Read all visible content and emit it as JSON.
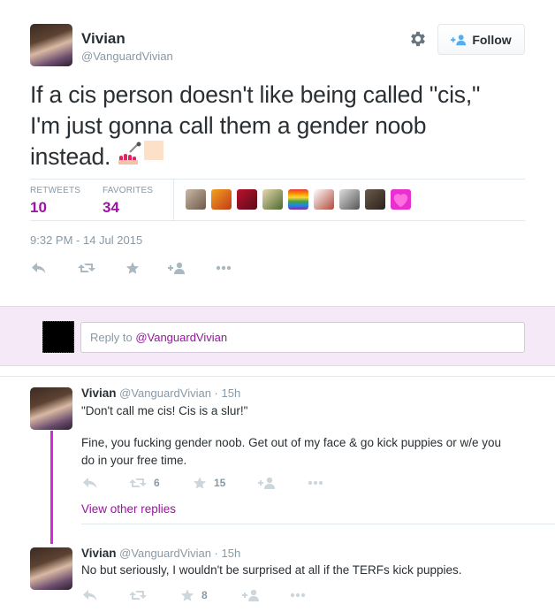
{
  "tweet": {
    "author_name": "Vivian",
    "author_handle": "@VanguardVivian",
    "follow_label": "Follow",
    "text_lines": [
      "If a cis person doesn't like being called \"cis,\"",
      "I'm just gonna call them a gender noob",
      "instead."
    ],
    "retweets_label": "RETWEETS",
    "retweets_count": "10",
    "favorites_label": "FAVORITES",
    "favorites_count": "34",
    "timestamp": "9:32 PM - 14 Jul 2015"
  },
  "reply_box": {
    "prefix": "Reply to ",
    "mention": "@VanguardVivian"
  },
  "replies": [
    {
      "name": "Vivian",
      "handle_time": "@VanguardVivian · 15h",
      "line1": "\"Don't call me cis! Cis is a slur!\"",
      "line2": "Fine, you fucking gender noob. Get out of my face & go kick puppies or w/e you",
      "line3": "do in your free time.",
      "retweets": "6",
      "favorites": "15"
    },
    {
      "name": "Vivian",
      "handle_time": "@VanguardVivian · 15h",
      "line1": "No but seriously, I wouldn't be surprised at all if the TERFs kick puppies.",
      "retweets": "",
      "favorites": "8"
    }
  ],
  "view_other_replies": "View other replies",
  "colors": {
    "accent": "#9b13a2",
    "thread_line": "#d12cd6",
    "reply_band": "#f6e9f7",
    "muted": "#8899a6",
    "icon": "#aab8c2"
  },
  "icons": [
    "gear-icon",
    "follow-person-icon",
    "reply-icon",
    "retweet-icon",
    "favorite-star-icon",
    "follow-add-icon",
    "more-dots-icon",
    "nail-polish-emoji",
    "skin-tone-square-emoji"
  ]
}
